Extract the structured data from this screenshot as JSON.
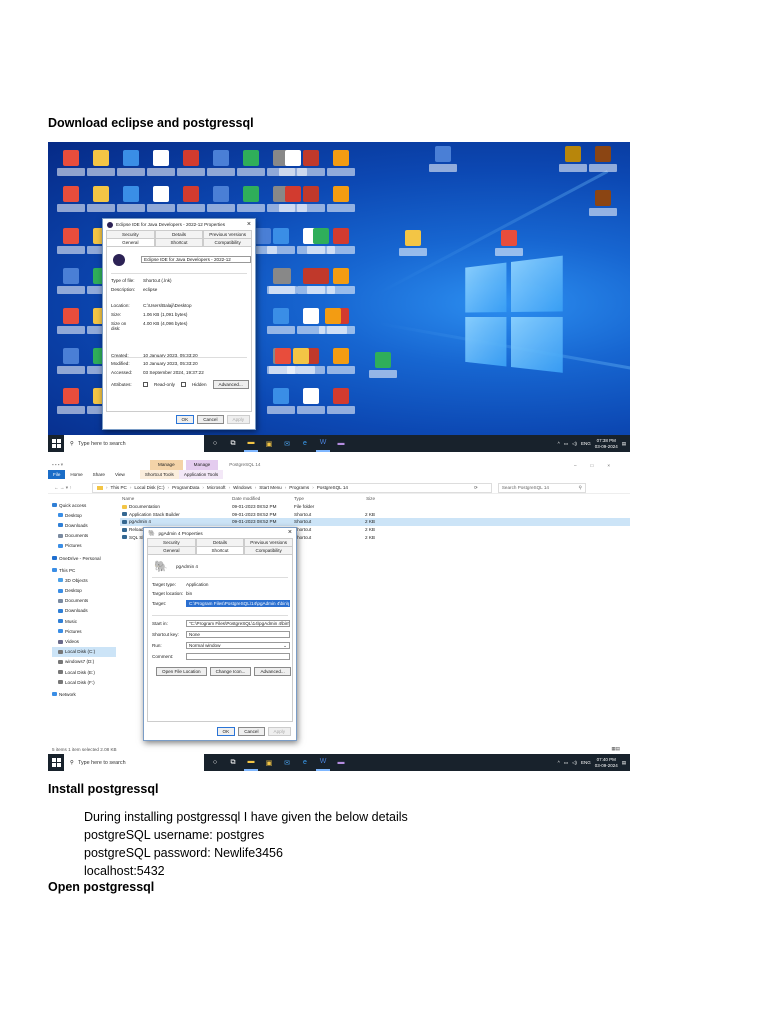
{
  "document": {
    "heading1": "Download eclipse and postgressql",
    "heading2": "Install postgressql",
    "install_lines": [
      "During installing postgressql I have given the below details",
      "postgreSQL username: postgres",
      "postgreSQL password: Newlife3456",
      "localhost:5432"
    ],
    "heading3": "Open postgressql"
  },
  "screenshot1": {
    "dialog": {
      "title": "Eclipse IDE for Java Developers - 2022-12 Properties",
      "close_glyph": "×",
      "tabs_row1": [
        "Security",
        "Details",
        "Previous Versions"
      ],
      "tabs_row2": [
        "General",
        "Shortcut",
        "Compatibility"
      ],
      "name_value": "Eclipse IDE for Java Developers - 2022-12",
      "fields": [
        {
          "label": "Type of file:",
          "value": "Shortcut (.lnk)"
        },
        {
          "label": "Description:",
          "value": "eclipse"
        },
        {
          "label": "Location:",
          "value": "C:\\Users\\Balaji\\Desktop"
        },
        {
          "label": "Size:",
          "value": "1.06 KB (1,091 bytes)"
        },
        {
          "label": "Size on disk:",
          "value": "4.00 KB (4,096 bytes)"
        },
        {
          "label": "Created:",
          "value": "10 January 2023, 05:33:20"
        },
        {
          "label": "Modified:",
          "value": "10 January 2023, 05:33:20"
        },
        {
          "label": "Accessed:",
          "value": "03 September 2024, 19:37:22"
        }
      ],
      "attributes_label": "Attributes:",
      "readonly_label": "Read-only",
      "hidden_label": "Hidden",
      "advanced_button": "Advanced...",
      "ok_button": "OK",
      "cancel_button": "Cancel",
      "apply_button": "Apply"
    },
    "taskbar": {
      "search_placeholder": "Type here to search",
      "language": "ENG",
      "time": "07:38 PM",
      "date": "03-09-2024"
    }
  },
  "screenshot2": {
    "context_tabs": [
      "Manage",
      "Manage",
      "PostgreSQL 14"
    ],
    "ribbon_tabs": [
      "File",
      "Home",
      "Share",
      "View",
      "Shortcut Tools",
      "Application Tools"
    ],
    "breadcrumb": [
      "This PC",
      "Local Disk (C:)",
      "ProgramData",
      "Microsoft",
      "Windows",
      "Start Menu",
      "Programs",
      "PostgreSQL 14"
    ],
    "search_placeholder": "Search PostgreSQL 14",
    "nav_items": [
      {
        "label": "Quick access",
        "indent": false,
        "selected": false,
        "color": "#2f7fd6"
      },
      {
        "label": "Desktop",
        "indent": true,
        "selected": false,
        "color": "#3a8ee6"
      },
      {
        "label": "Downloads",
        "indent": true,
        "selected": false,
        "color": "#2f7fd6"
      },
      {
        "label": "Documents",
        "indent": true,
        "selected": false,
        "color": "#7a8aa0"
      },
      {
        "label": "Pictures",
        "indent": true,
        "selected": false,
        "color": "#3a8ee6"
      },
      {
        "label": "OneDrive - Personal",
        "indent": false,
        "selected": false,
        "color": "#1f6fd0"
      },
      {
        "label": "This PC",
        "indent": false,
        "selected": false,
        "color": "#3a8ee6"
      },
      {
        "label": "3D Objects",
        "indent": true,
        "selected": false,
        "color": "#4aa0e8"
      },
      {
        "label": "Desktop",
        "indent": true,
        "selected": false,
        "color": "#3a8ee6"
      },
      {
        "label": "Documents",
        "indent": true,
        "selected": false,
        "color": "#7a8aa0"
      },
      {
        "label": "Downloads",
        "indent": true,
        "selected": false,
        "color": "#2f7fd6"
      },
      {
        "label": "Music",
        "indent": true,
        "selected": false,
        "color": "#2f7fd6"
      },
      {
        "label": "Pictures",
        "indent": true,
        "selected": false,
        "color": "#3a8ee6"
      },
      {
        "label": "Videos",
        "indent": true,
        "selected": false,
        "color": "#6a6a8a"
      },
      {
        "label": "Local Disk (C:)",
        "indent": true,
        "selected": true,
        "color": "#777777"
      },
      {
        "label": "windows7 (D:)",
        "indent": true,
        "selected": false,
        "color": "#777777"
      },
      {
        "label": "Local Disk (E:)",
        "indent": true,
        "selected": false,
        "color": "#777777"
      },
      {
        "label": "Local Disk (F:)",
        "indent": true,
        "selected": false,
        "color": "#777777"
      },
      {
        "label": "Network",
        "indent": false,
        "selected": false,
        "color": "#3a8ee6"
      }
    ],
    "columns": [
      "Name",
      "Date modified",
      "Type",
      "Size"
    ],
    "files": [
      {
        "name": "Documentation",
        "date": "09-01-2023 08:52 PM",
        "type": "File folder",
        "size": ""
      },
      {
        "name": "Application Stack Builder",
        "date": "09-01-2023 08:52 PM",
        "type": "Shortcut",
        "size": "2 KB"
      },
      {
        "name": "pgAdmin 4",
        "date": "09-01-2023 08:52 PM",
        "type": "Shortcut",
        "size": "2 KB"
      },
      {
        "name": "Reload Configuration",
        "date": "",
        "type": "Shortcut",
        "size": "2 KB"
      },
      {
        "name": "SQL Shell (psql)",
        "date": "",
        "type": "Shortcut",
        "size": "2 KB"
      }
    ],
    "status": "5 items    1 item selected  2.08 KB",
    "dialog": {
      "title": "pgAdmin 4 Properties",
      "close_glyph": "×",
      "tabs_row1": [
        "Security",
        "Details",
        "Previous Versions"
      ],
      "tabs_row2": [
        "General",
        "Shortcut",
        "Compatibility"
      ],
      "name_value": "pgAdmin 4",
      "target_type_label": "Target type:",
      "target_type": "Application",
      "target_location_label": "Target location:",
      "target_location": "bin",
      "target_label": "Target:",
      "target": "C:\\Program Files\\PostgreSQL\\14\\pgAdmin 4\\bin\\pgAdmin4.exe",
      "start_in_label": "Start in:",
      "start_in": "\"C:\\Program Files\\PostgreSQL\\14\\pgAdmin 4\\bin\"",
      "shortcut_key_label": "Shortcut key:",
      "shortcut_key": "None",
      "run_label": "Run:",
      "run": "Normal window",
      "comment_label": "Comment:",
      "open_location_button": "Open File Location",
      "change_icon_button": "Change Icon...",
      "advanced_button": "Advanced...",
      "ok_button": "OK",
      "cancel_button": "Cancel",
      "apply_button": "Apply"
    },
    "taskbar": {
      "search_placeholder": "Type here to search",
      "language": "ENG",
      "time": "07:40 PM",
      "date": "03-09-2024"
    }
  },
  "colors": {
    "desktop_blue": "#0c48b3",
    "taskbar": "#18222c",
    "explorer_file_tab": "#1a6dc8",
    "selection": "#cce4f7"
  }
}
